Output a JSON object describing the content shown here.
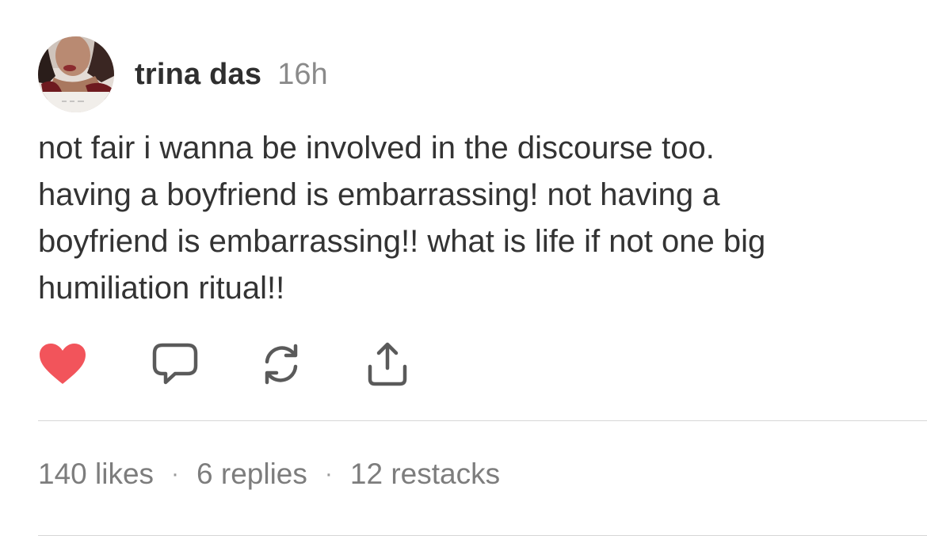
{
  "post": {
    "author": {
      "name": "trina das",
      "avatar_icon": "profile-photo"
    },
    "time": "16h",
    "body_lines": [
      "not fair i wanna be involved in the discourse too.",
      "having a boyfriend is embarrassing! not having a",
      "boyfriend is embarrassing!! what is life if not one big",
      "humiliation ritual!!"
    ],
    "actions": {
      "like_icon": "heart-icon",
      "like_color": "#f2545b",
      "reply_icon": "comment-icon",
      "restack_icon": "restack-icon",
      "share_icon": "share-icon",
      "icon_color": "#5a5a5a"
    },
    "stats": {
      "likes": "140 likes",
      "replies": "6 replies",
      "restacks": "12 restacks",
      "separator": "·"
    }
  }
}
